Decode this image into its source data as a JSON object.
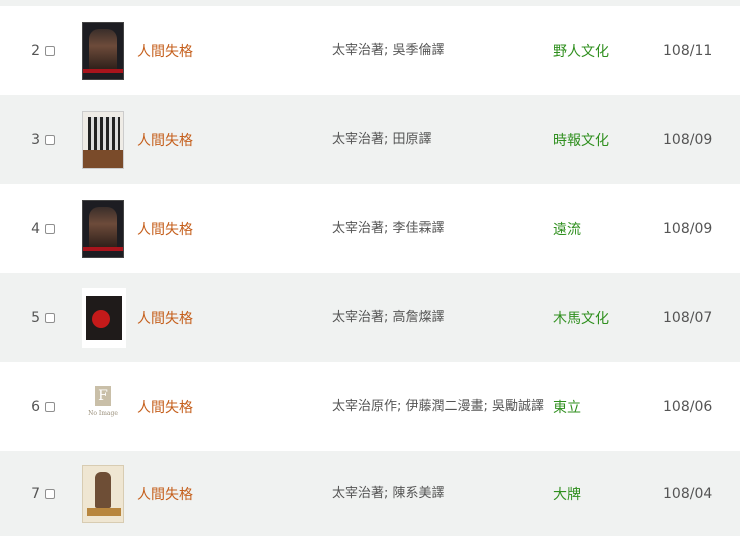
{
  "rows": [
    {
      "num": "2",
      "title": "人間失格",
      "author": "太宰治著; 吳季倫譯",
      "publisher": "野人文化",
      "date": "108/11",
      "cover": "dark-portrait-cover"
    },
    {
      "num": "3",
      "title": "人間失格",
      "author": "太宰治著; 田原譯",
      "publisher": "時報文化",
      "date": "108/09",
      "cover": "monochrome-photo-cover"
    },
    {
      "num": "4",
      "title": "人間失格",
      "author": "太宰治著; 李佳霖譯",
      "publisher": "遠流",
      "date": "108/09",
      "cover": "dark-portrait-cover"
    },
    {
      "num": "5",
      "title": "人間失格",
      "author": "太宰治著; 高詹燦譯",
      "publisher": "木馬文化",
      "date": "108/07",
      "cover": "black-red-cover"
    },
    {
      "num": "6",
      "title": "人間失格",
      "author": "太宰治原作; 伊藤潤二漫畫; 吳勵誠譯",
      "publisher": "東立",
      "date": "108/06",
      "cover": "no-image-placeholder",
      "no_image_label": "No Image",
      "no_image_letter": "F"
    },
    {
      "num": "7",
      "title": "人間失格",
      "author": "太宰治著; 陳系美譯",
      "publisher": "大牌",
      "date": "108/04",
      "cover": "beige-illustrated-cover"
    }
  ],
  "colors": {
    "title_link": "#c55f1c",
    "publisher_link": "#2f8f1e",
    "row_alt_bg": "#f0f2f1"
  }
}
